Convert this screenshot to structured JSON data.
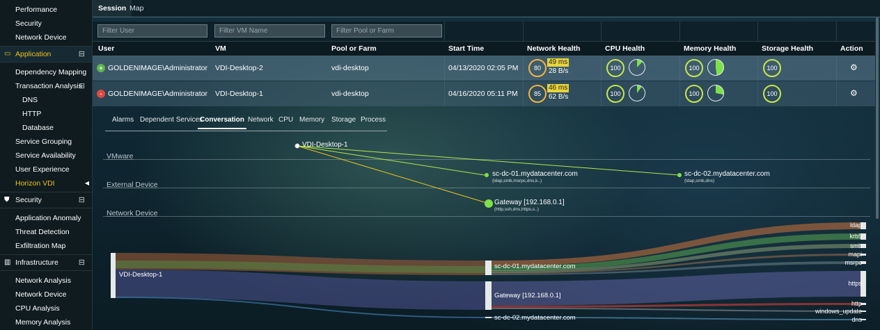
{
  "sidebar": {
    "items_top": [
      {
        "label": "Performance"
      },
      {
        "label": "Security"
      },
      {
        "label": "Network Device"
      }
    ],
    "application": {
      "label": "Application",
      "toggle": "⊟",
      "items": [
        {
          "label": "Dependency Mapping"
        },
        {
          "label": "Transaction Analysis",
          "toggle": "⊟"
        },
        {
          "label": "DNS"
        },
        {
          "label": "HTTP"
        },
        {
          "label": "Database"
        },
        {
          "label": "Service Grouping"
        },
        {
          "label": "Service Availability"
        },
        {
          "label": "User Experience"
        },
        {
          "label": "Horizon VDI"
        }
      ]
    },
    "security": {
      "label": "Security",
      "toggle": "⊟",
      "items": [
        {
          "label": "Application Anomaly"
        },
        {
          "label": "Threat Detection"
        },
        {
          "label": "Exfiltration Map"
        }
      ]
    },
    "infrastructure": {
      "label": "Infrastructure",
      "toggle": "⊟",
      "items": [
        {
          "label": "Network Analysis"
        },
        {
          "label": "Network Device"
        },
        {
          "label": "CPU Analysis"
        },
        {
          "label": "Memory Analysis"
        }
      ]
    }
  },
  "top_tabs": [
    {
      "label": "Session"
    },
    {
      "label": "Map"
    }
  ],
  "filters": {
    "user": "Filter User",
    "vm": "Filter VM Name",
    "pool": "Filter Pool or Farm"
  },
  "table": {
    "headers": [
      "User",
      "VM",
      "Pool or Farm",
      "Start Time",
      "Network Health",
      "CPU Health",
      "Memory Health",
      "Storage Health",
      "Action"
    ],
    "rows": [
      {
        "status": "+",
        "user": "GOLDENIMAGE\\Administrator",
        "vm": "VDI-Desktop-2",
        "pool": "vdi-desktop",
        "start": "04/13/2020 02:05 PM",
        "net_score": "80",
        "net_ms": "49 ms",
        "net_bs": "28 B/s",
        "cpu": "100",
        "cpu_pie_pct": 12,
        "mem": "100",
        "mem_pie_pct": 48,
        "storage": "100"
      },
      {
        "status": "-",
        "user": "GOLDENIMAGE\\Administrator",
        "vm": "VDI-Desktop-1",
        "pool": "vdi-desktop",
        "start": "04/16/2020 05:11 PM",
        "net_score": "85",
        "net_ms": "46 ms",
        "net_bs": "62 B/s",
        "cpu": "100",
        "cpu_pie_pct": 10,
        "mem": "100",
        "mem_pie_pct": 28,
        "storage": "100"
      }
    ]
  },
  "detail_tabs": [
    {
      "label": "Alarms"
    },
    {
      "label": "Dependent Services"
    },
    {
      "label": "Conversation"
    },
    {
      "label": "Network"
    },
    {
      "label": "CPU"
    },
    {
      "label": "Memory"
    },
    {
      "label": "Storage"
    },
    {
      "label": "Process"
    }
  ],
  "graph": {
    "lanes": [
      "VMware",
      "External Device",
      "Network Device"
    ],
    "source": "VDI-Desktop-1",
    "targets": [
      {
        "label": "sc-dc-01.mydatacenter.com",
        "sub": "(ldap,smb,msrpc,dns,k..)"
      },
      {
        "label": "sc-dc-02.mydatacenter.com",
        "sub": "(ldap,smb,dns)"
      },
      {
        "label": "Gateway [192.168.0.1]",
        "sub": "(http,ssh,dns,https,s..)"
      }
    ]
  },
  "sankey": {
    "left": "VDI-Desktop-1",
    "middle": [
      "sc-dc-01.mydatacenter.com",
      "Gateway [192.168.0.1]",
      "sc-dc-02.mydatacenter.com"
    ],
    "right": [
      "ldap",
      "krb5",
      "smb",
      "mapi",
      "msrpc",
      "https",
      "http",
      "windows_update",
      "dns"
    ]
  },
  "colors": {
    "accent": "#f0c419",
    "good": "#5fb64d",
    "bad": "#e04a3f",
    "gauge": "#c8e84a"
  }
}
